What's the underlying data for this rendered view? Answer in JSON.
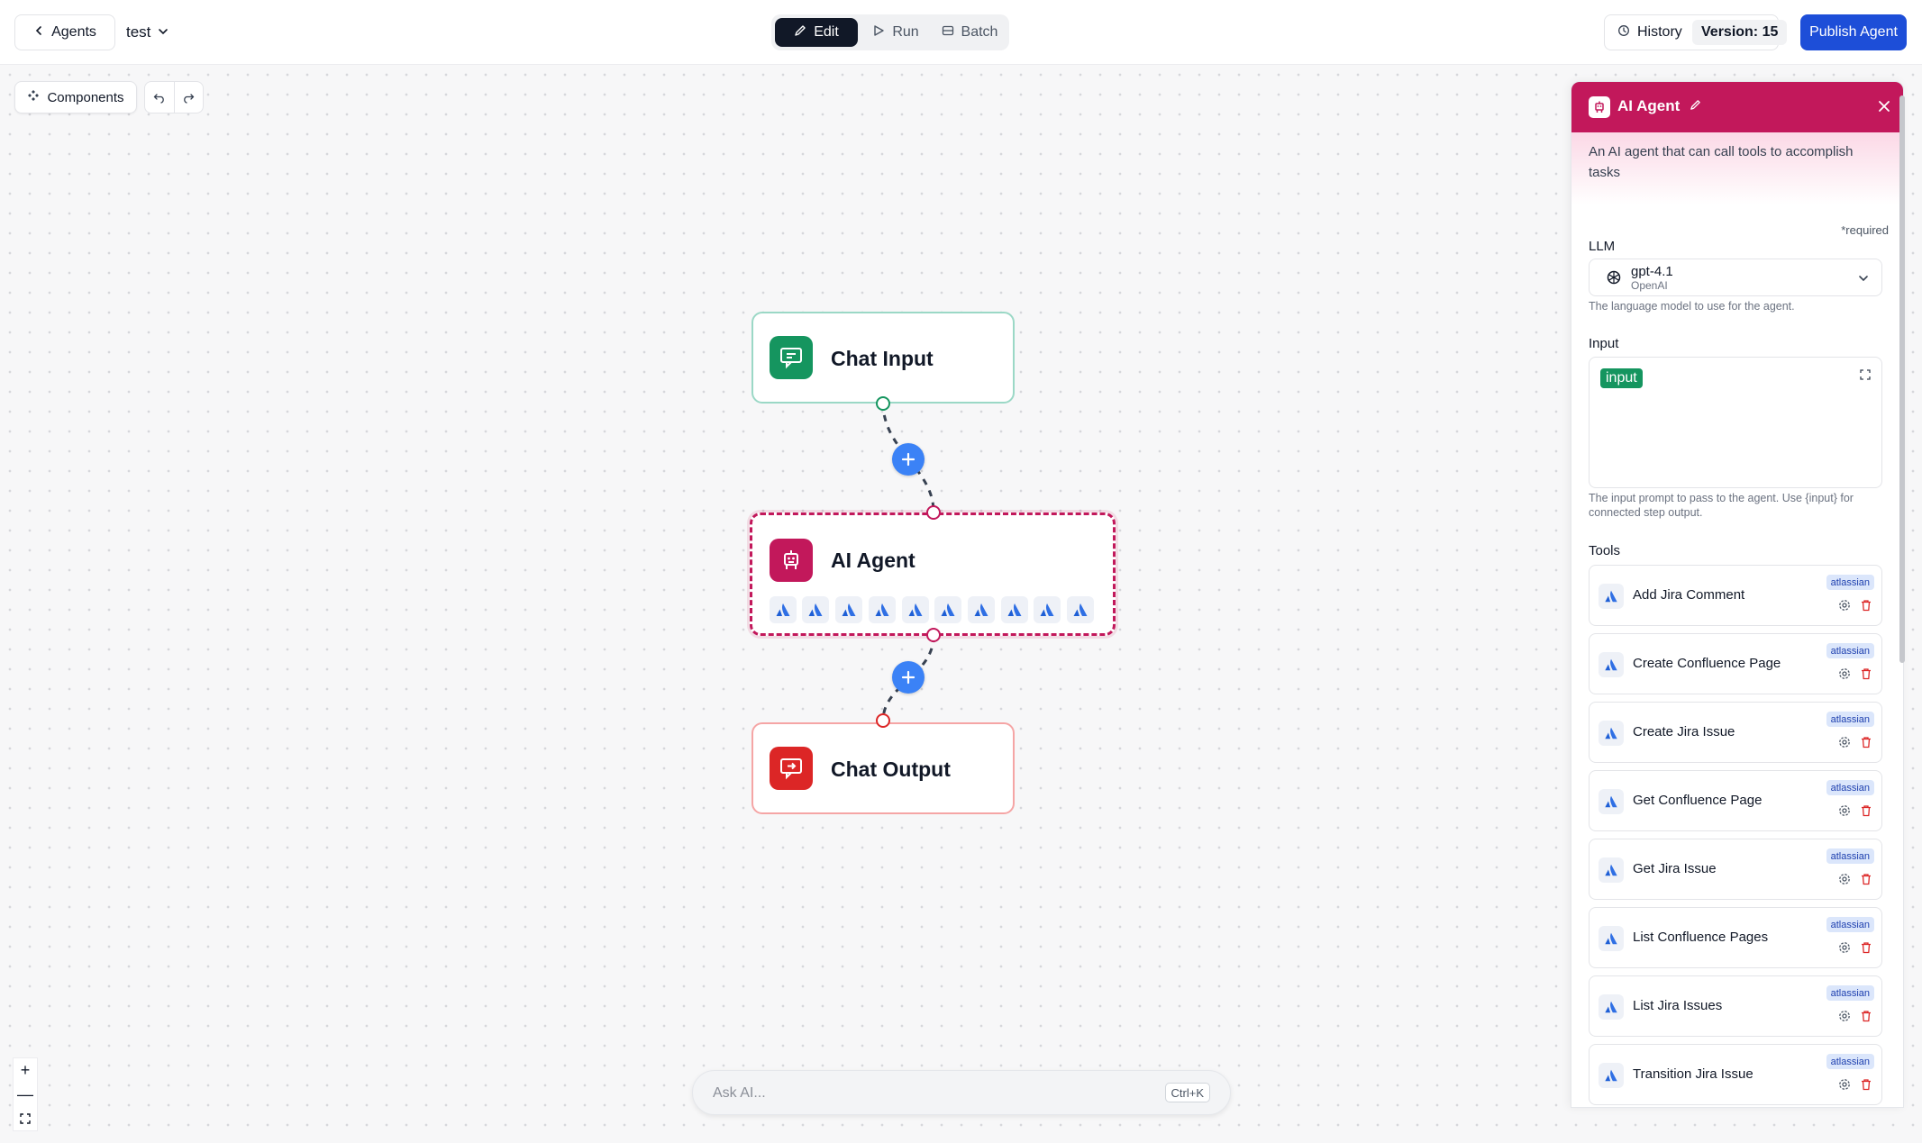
{
  "topbar": {
    "back_label": "Agents",
    "agent_name": "test",
    "modes": [
      {
        "label": "Edit",
        "active": true,
        "icon": "pencil-icon"
      },
      {
        "label": "Run",
        "active": false,
        "icon": "play-icon"
      },
      {
        "label": "Batch",
        "active": false,
        "icon": "batch-icon"
      }
    ],
    "history_label": "History",
    "version_label": "Version: 15",
    "publish_label": "Publish Agent"
  },
  "canvas": {
    "components_label": "Components",
    "undo_icon": "undo-icon",
    "redo_icon": "redo-icon",
    "nodes": {
      "chat_input": "Chat Input",
      "ai_agent": "AI Agent",
      "chat_output": "Chat Output"
    },
    "agent_tool_count": 10,
    "zoom_controls": [
      "+",
      "—",
      "fit"
    ]
  },
  "ask_ai": {
    "placeholder": "Ask AI...",
    "shortcut": "Ctrl+K"
  },
  "panel": {
    "title": "AI Agent",
    "description": "An AI agent that can call tools to accomplish tasks",
    "required_note": "*required",
    "llm": {
      "label": "LLM",
      "model": "gpt-4.1",
      "provider": "OpenAI",
      "hint": "The language model to use for the agent."
    },
    "input": {
      "label": "Input",
      "variable": "input",
      "hint": "The input prompt to pass to the agent. Use {input} for connected step output."
    },
    "tools_label": "Tools",
    "tools": [
      {
        "name": "Add Jira Comment",
        "badge": "atlassian"
      },
      {
        "name": "Create Confluence Page",
        "badge": "atlassian"
      },
      {
        "name": "Create Jira Issue",
        "badge": "atlassian"
      },
      {
        "name": "Get Confluence Page",
        "badge": "atlassian"
      },
      {
        "name": "Get Jira Issue",
        "badge": "atlassian"
      },
      {
        "name": "List Confluence Pages",
        "badge": "atlassian"
      },
      {
        "name": "List Jira Issues",
        "badge": "atlassian"
      },
      {
        "name": "Transition Jira Issue",
        "badge": "atlassian"
      }
    ]
  },
  "colors": {
    "accent": "#1d4ed8",
    "agent": "#c2185b",
    "chat_input": "#15955f",
    "chat_output": "#dc2626",
    "plus": "#3b82f6"
  }
}
